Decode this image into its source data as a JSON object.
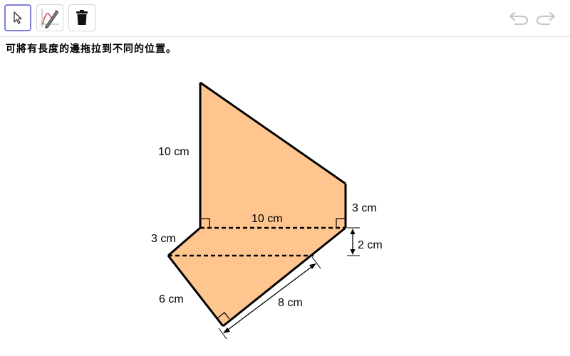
{
  "toolbar": {
    "tools": [
      {
        "id": "move",
        "icon": "move-cursor-icon",
        "selected": true
      },
      {
        "id": "pen",
        "icon": "pen-graph-icon",
        "selected": false
      },
      {
        "id": "delete",
        "icon": "trash-icon",
        "selected": false
      }
    ],
    "undo_icon": "undo-icon",
    "redo_icon": "redo-icon"
  },
  "instruction": "可將有長度的邊拖拉到不同的位置。",
  "figure": {
    "fill_color": "#ffc58f",
    "stroke_color": "#000000",
    "labels": {
      "left_height": "10 cm",
      "middle_width": "10 cm",
      "right_height": "3 cm",
      "lower_left_short": "3 cm",
      "right_gap": "2 cm",
      "lower_left_long": "6 cm",
      "bottom_slant": "8 cm"
    }
  }
}
